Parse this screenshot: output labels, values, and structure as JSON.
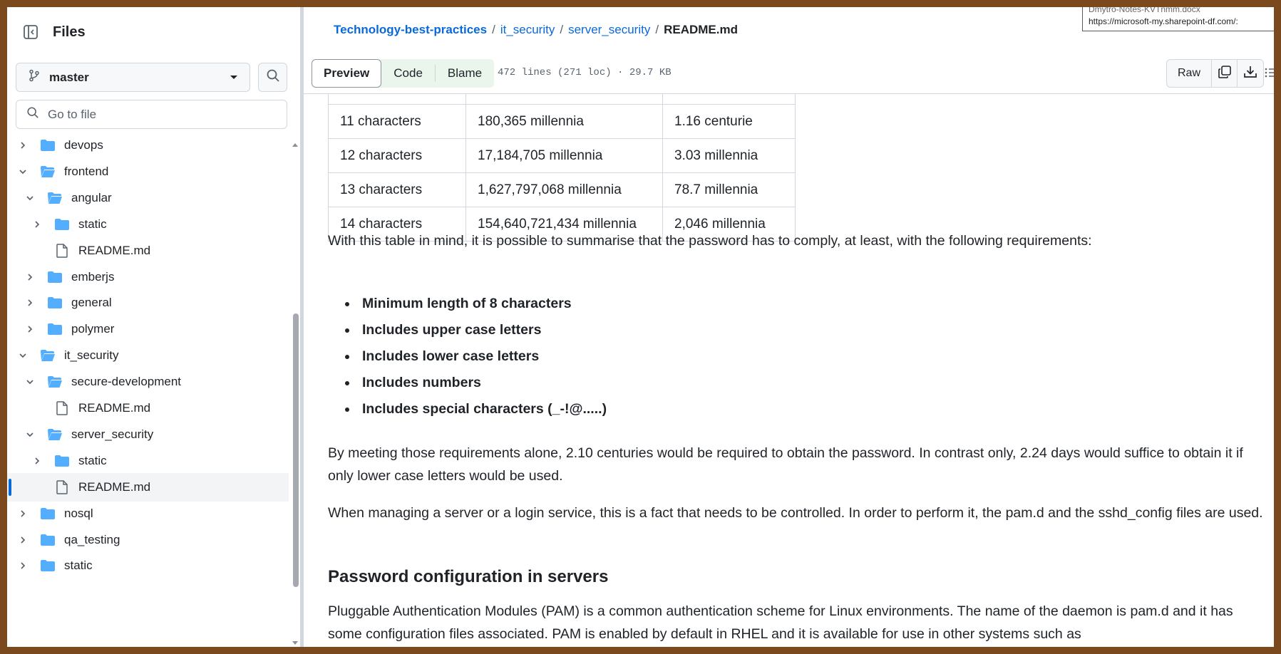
{
  "sidebar": {
    "title": "Files",
    "branch": "master",
    "goto_placeholder": "Go to file",
    "tree": [
      {
        "label": "devops",
        "type": "folder",
        "expanded": false,
        "level": 0
      },
      {
        "label": "frontend",
        "type": "folder",
        "expanded": true,
        "level": 0
      },
      {
        "label": "angular",
        "type": "folder",
        "expanded": true,
        "level": 1
      },
      {
        "label": "static",
        "type": "folder",
        "expanded": false,
        "level": 2
      },
      {
        "label": "README.md",
        "type": "file",
        "level": 2
      },
      {
        "label": "emberjs",
        "type": "folder",
        "expanded": false,
        "level": 1
      },
      {
        "label": "general",
        "type": "folder",
        "expanded": false,
        "level": 1
      },
      {
        "label": "polymer",
        "type": "folder",
        "expanded": false,
        "level": 1
      },
      {
        "label": "it_security",
        "type": "folder",
        "expanded": true,
        "level": 0
      },
      {
        "label": "secure-development",
        "type": "folder",
        "expanded": true,
        "level": 1
      },
      {
        "label": "README.md",
        "type": "file",
        "level": 2
      },
      {
        "label": "server_security",
        "type": "folder",
        "expanded": true,
        "level": 1
      },
      {
        "label": "static",
        "type": "folder",
        "expanded": false,
        "level": 2
      },
      {
        "label": "README.md",
        "type": "file",
        "level": 2,
        "selected": true
      },
      {
        "label": "nosql",
        "type": "folder",
        "expanded": false,
        "level": 0
      },
      {
        "label": "qa_testing",
        "type": "folder",
        "expanded": false,
        "level": 0
      },
      {
        "label": "static",
        "type": "folder",
        "expanded": false,
        "level": 0
      }
    ]
  },
  "breadcrumb": {
    "repo": "Technology-best-practices",
    "parts": [
      "it_security",
      "server_security"
    ],
    "current": "README.md",
    "separator": "/"
  },
  "tooltip": {
    "line1": "Dmytro-Notes-KVTnmm.docx",
    "line2": "https://microsoft-my.sharepoint-df.com/:"
  },
  "toolbar": {
    "tabs": [
      "Preview",
      "Code",
      "Blame"
    ],
    "active_tab": "Preview",
    "file_info": "472 lines (271 loc) · 29.7 KB",
    "raw_label": "Raw"
  },
  "table": {
    "rows": [
      [
        "11 characters",
        "180,365 millennia",
        "1.16 centurie"
      ],
      [
        "12 characters",
        "17,184,705 millennia",
        "3.03 millennia"
      ],
      [
        "13 characters",
        "1,627,797,068 millennia",
        "78.7 millennia"
      ],
      [
        "14 characters",
        "154,640,721,434 millennia",
        "2,046 millennia"
      ]
    ]
  },
  "content": {
    "intro": "With this table in mind, it is possible to summarise that the password has to comply, at least, with the following requirements:",
    "requirements": [
      "Minimum length of 8 characters",
      "Includes upper case letters",
      "Includes lower case letters",
      "Includes numbers",
      "Includes special characters (_-!@.....)"
    ],
    "para1": "By meeting those requirements alone, 2.10 centuries would be required to obtain the password. In contrast only, 2.24 days would suffice to obtain it if only lower case letters would be used.",
    "para2": "When managing a server or a login service, this is a fact that needs to be controlled. In order to perform it, the pam.d and the sshd_config files are used.",
    "heading": "Password configuration in servers",
    "para3": "Pluggable Authentication Modules (PAM) is a common authentication scheme for Linux environments. The name of the daemon is pam.d and it has some configuration files associated. PAM is enabled by default in RHEL and it is available for use in other systems such as"
  },
  "colors": {
    "link": "#0969da",
    "folder": "#54aeff",
    "border": "#d0d7de",
    "frame": "#7a4a1e"
  }
}
